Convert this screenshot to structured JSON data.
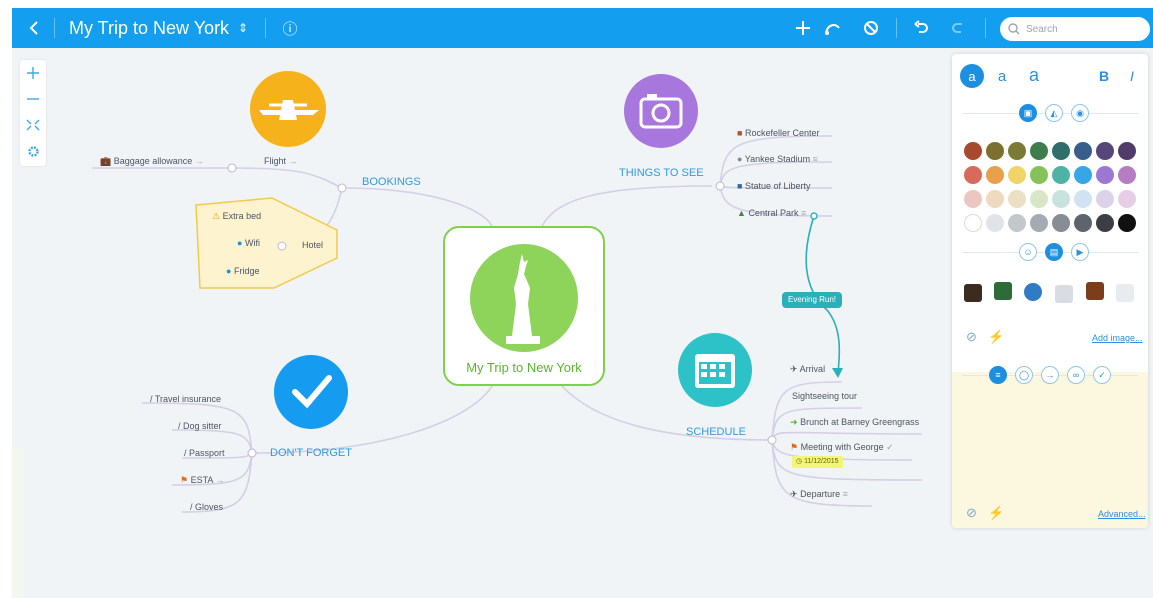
{
  "topbar": {
    "title": "My Trip to New York",
    "title_arrows": "⇕",
    "info_icon": "ⓘ",
    "search_placeholder": "Search"
  },
  "central": {
    "title": "My Trip to New York"
  },
  "bookings": {
    "label": "BOOKINGS",
    "flight": "Flight",
    "baggage": "Baggage allowance",
    "hotel": "Hotel",
    "hotel_items": [
      "Extra bed",
      "Wifi",
      "Fridge"
    ]
  },
  "things_to_see": {
    "label": "THINGS TO SEE",
    "items": [
      "Rockefeller Center",
      "Yankee Stadium",
      "Statue of Liberty",
      "Central Park"
    ],
    "link_label": "Evening Run!"
  },
  "dont_forget": {
    "label": "DON'T FORGET",
    "items": [
      "Travel insurance",
      "Dog sitter",
      "Passport",
      "ESTA",
      "Gloves"
    ]
  },
  "schedule": {
    "label": "SCHEDULE",
    "items": [
      "Arrival",
      "Sightseeing tour",
      "Brunch at Barney Greengrass",
      "Meeting with George",
      "Departure"
    ],
    "date": "11/12/2015"
  },
  "panel": {
    "font_sizes": [
      "a",
      "a",
      "a"
    ],
    "bold": "B",
    "italic": "I",
    "add_image": "Add image...",
    "advanced": "Advanced..."
  },
  "colors": {
    "topbar": "#139eef",
    "accent": "#2f9ae0",
    "central_green": "#7fd04d",
    "flight_orange": "#f6b21b",
    "camera_purple": "#a877dd",
    "check_blue": "#159cf0",
    "calendar_teal": "#2cc2c8",
    "link_teal": "#2ab0b8"
  }
}
